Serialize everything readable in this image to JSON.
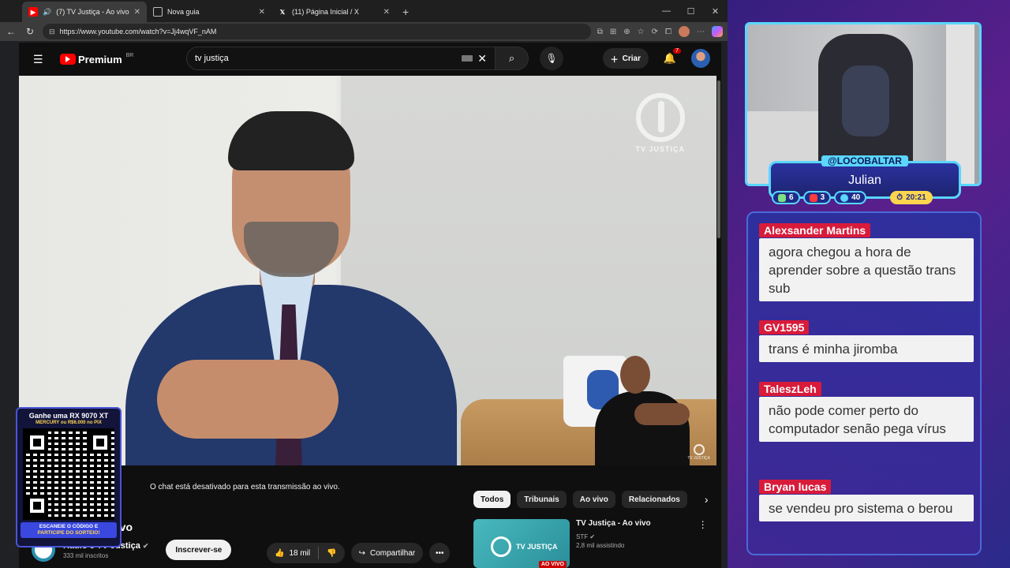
{
  "browser": {
    "tabs": [
      {
        "title": "(7) TV Justiça - Ao vivo - You",
        "active": true
      },
      {
        "title": "Nova guia",
        "active": false
      },
      {
        "title": "(11) Página Inicial / X",
        "active": false
      }
    ],
    "url": "https://www.youtube.com/watch?v=Jj4wqVF_nAM"
  },
  "youtube": {
    "logo_text": "Premium",
    "logo_region": "BR",
    "search_query": "tv justiça",
    "create_label": "Criar",
    "notif_count": "7",
    "video_watermark": "TV JUSTIÇA",
    "video_mini_watermark": "TV JUSTIÇA",
    "chat_disabled": "O chat está desativado para esta transmissão ao vivo.",
    "title_partial": "vivo",
    "channel_name": "Rádio e TV Justiça",
    "channel_subs": "333 mil inscritos",
    "subscribe_label": "Inscrever-se",
    "likes": "18 mil",
    "share_label": "Compartilhar",
    "chips": [
      "Todos",
      "Tribunais",
      "Ao vivo",
      "Relacionados"
    ],
    "recommended": {
      "title": "TV Justiça - Ao vivo",
      "channel": "STF",
      "viewers": "2,8 mil assistindo",
      "thumb_text": "TV JUSTIÇA",
      "live_badge": "AO VIVO"
    }
  },
  "qr_card": {
    "title": "Ganhe uma RX 9070 XT",
    "subtitle": "MERCURY ou R$6.000 no PIX",
    "cta_line1": "ESCANEIE O CÓDIGO E",
    "cta_line2": "PARTICIPE DO SORTEIO!"
  },
  "streamer": {
    "handle": "@LOCOBALTAR",
    "name": "Julian",
    "stats": {
      "chat": "6",
      "youtube": "3",
      "viewers": "40",
      "time": "20:21"
    }
  },
  "chat": [
    {
      "author": "Alexsander Martins",
      "text": "agora chegou a hora de aprender sobre a questão trans sub"
    },
    {
      "author": "GV1595",
      "text": "trans é minha jiromba"
    },
    {
      "author": "TaleszLeh",
      "text": "não pode comer perto do computador senão pega vírus"
    },
    {
      "author": "Bryan lucas",
      "text": "se vendeu pro sistema o berou"
    }
  ],
  "colors": {
    "accent_cyan": "#5ad6ff",
    "author_red": "#d81b3a",
    "yt_red": "#ff0000"
  }
}
